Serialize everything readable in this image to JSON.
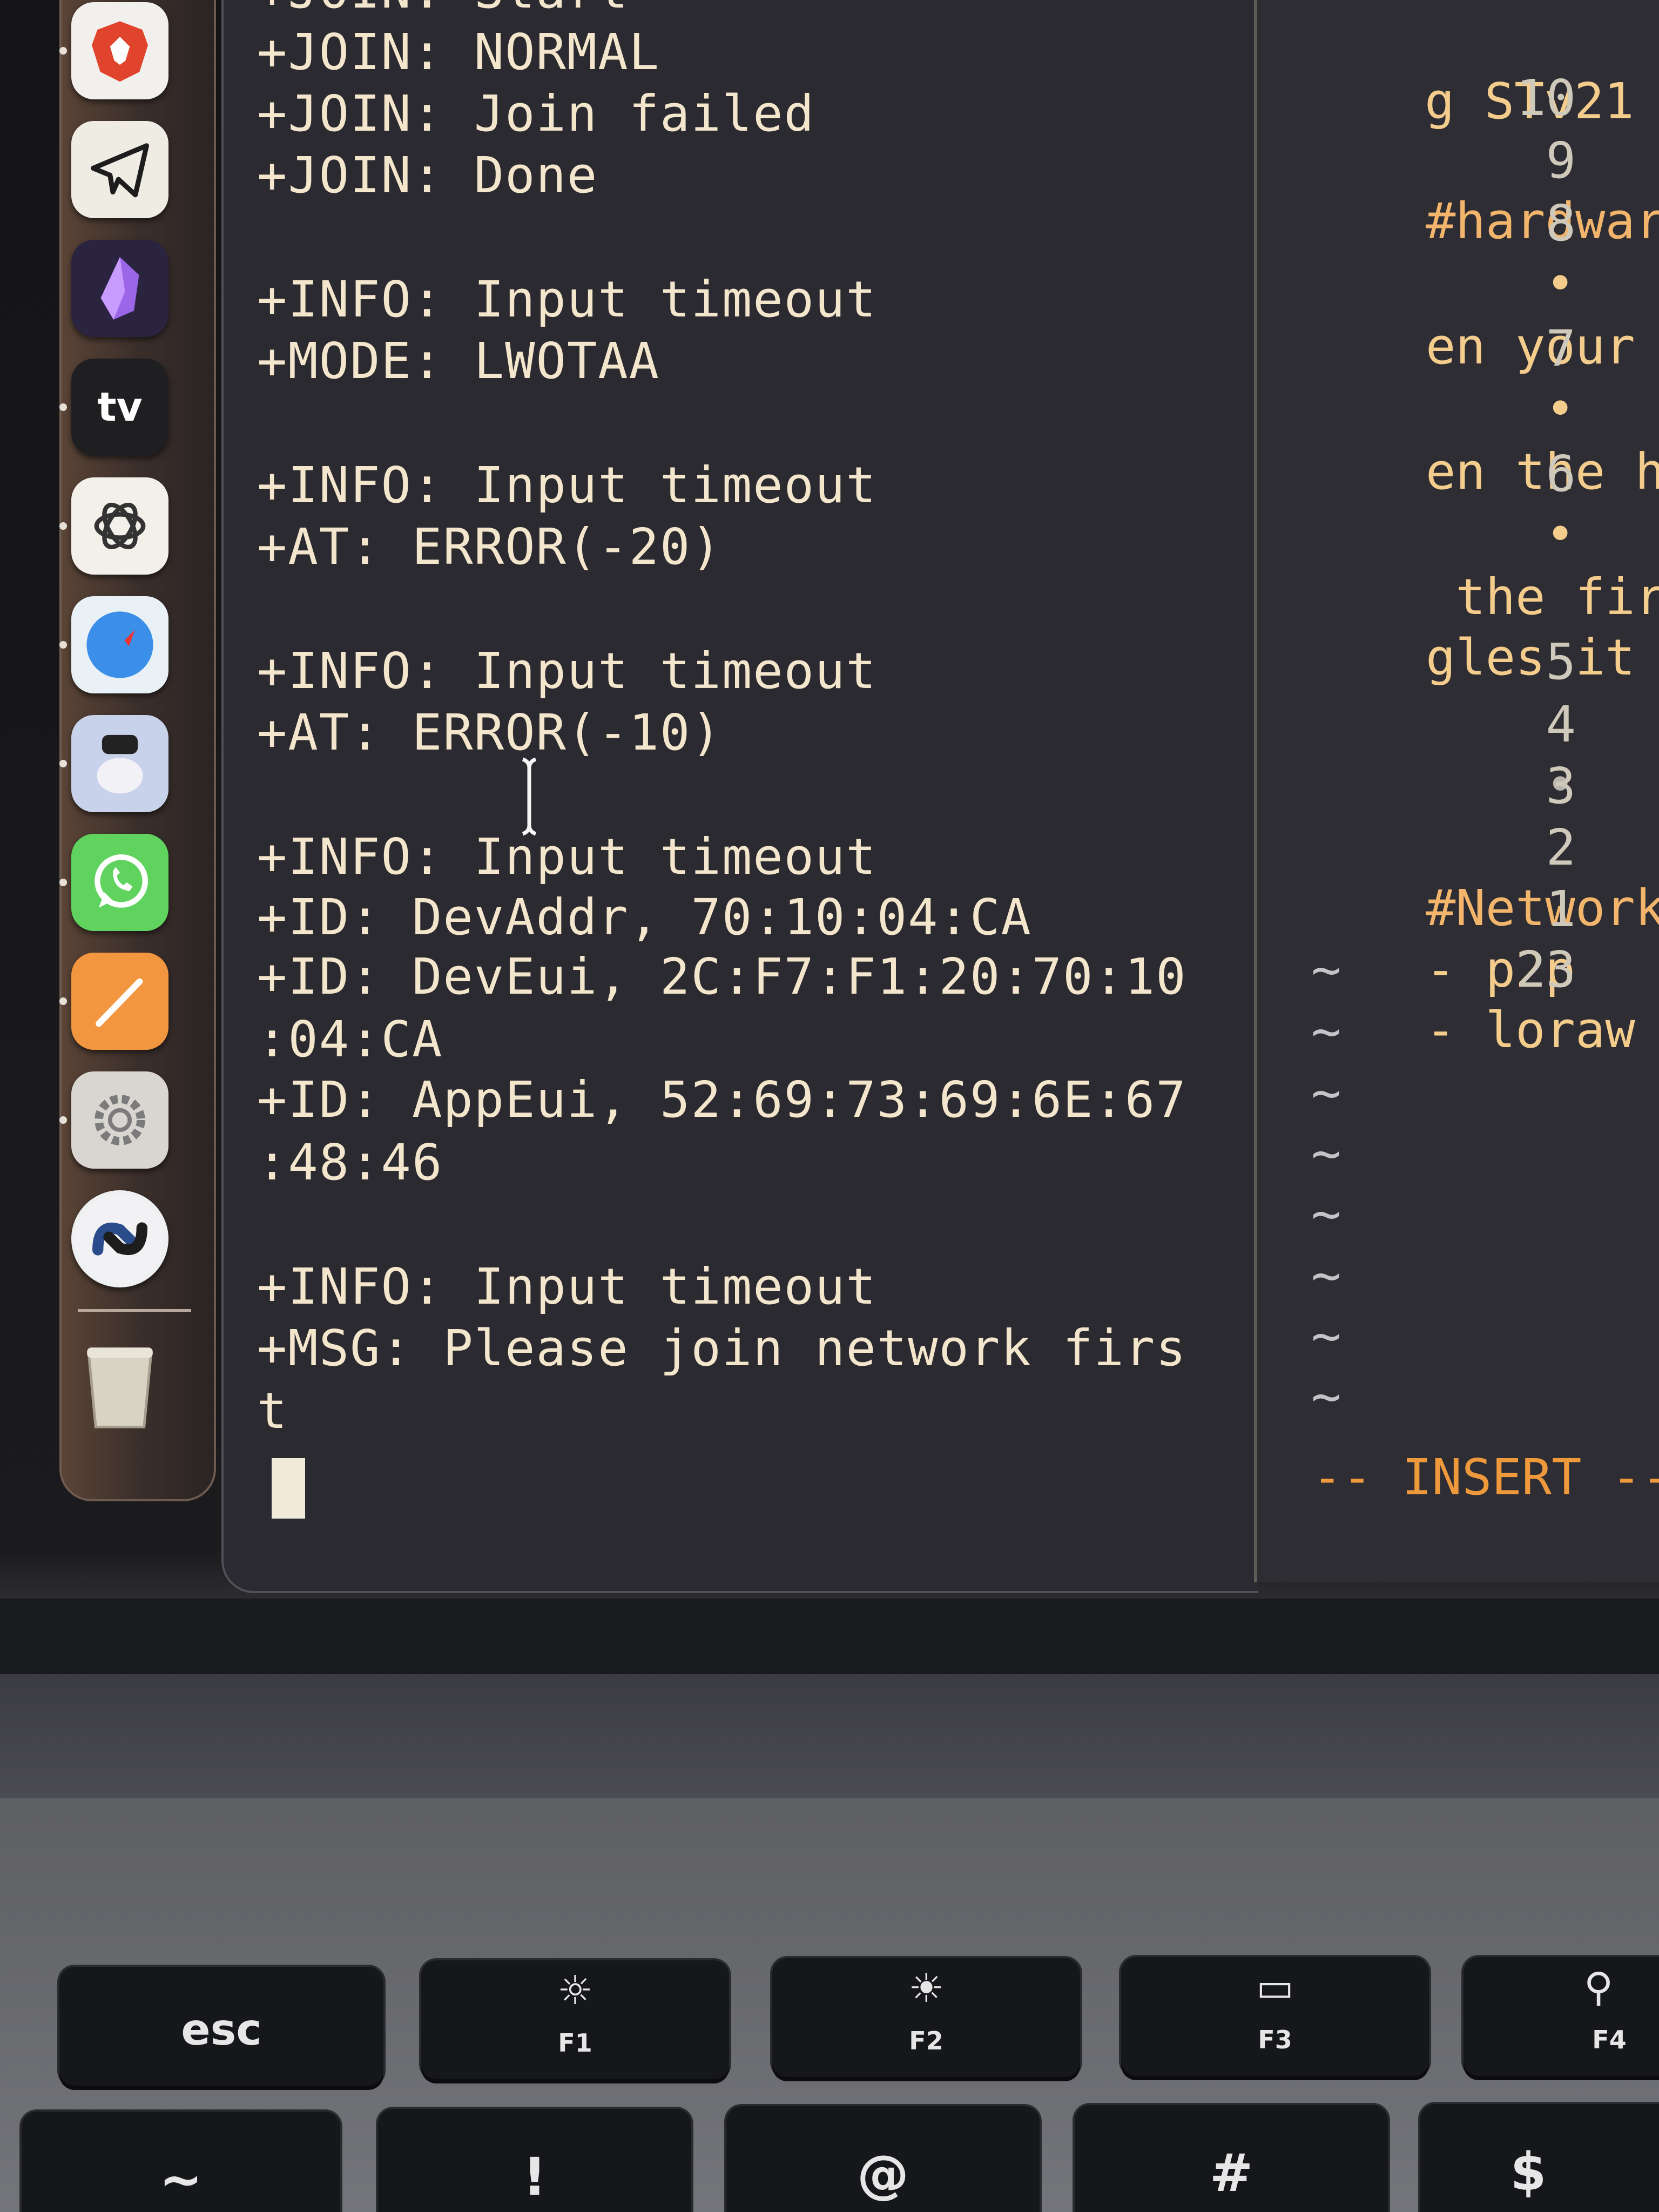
{
  "dock": {
    "items": [
      {
        "name": "brave-browser-icon",
        "glyph": "🦁",
        "bg": "#f2f0ed"
      },
      {
        "name": "telegram-icon",
        "glyph": "✈",
        "bg": "#efece4"
      },
      {
        "name": "obsidian-icon",
        "glyph": "◆",
        "bg": "#2b2440"
      },
      {
        "name": "apple-tv-icon",
        "glyph": "tv",
        "bg": "#1f1f22"
      },
      {
        "name": "chatgpt-icon",
        "glyph": "❀",
        "bg": "#f3f0ea"
      },
      {
        "name": "safari-icon",
        "glyph": "🧭",
        "bg": "#e9f0f6"
      },
      {
        "name": "preview-icon",
        "glyph": "◉",
        "bg": "#c8d2ea"
      },
      {
        "name": "whatsapp-icon",
        "glyph": "✆",
        "bg": "#5fd35e"
      },
      {
        "name": "pages-icon",
        "glyph": "✎",
        "bg": "#f29640"
      },
      {
        "name": "system-settings-icon",
        "glyph": "⚙",
        "bg": "#d9d6d1"
      },
      {
        "name": "sync-app-icon",
        "glyph": "⇄",
        "bg": "#eef0f2"
      },
      {
        "name": "trash-icon",
        "glyph": "🗑",
        "bg": "transparent"
      }
    ]
  },
  "terminal": {
    "lines": [
      "+JOIN: Start",
      "+JOIN: NORMAL",
      "+JOIN: Join failed",
      "+JOIN: Done",
      "",
      "+INFO: Input timeout",
      "+MODE: LWOTAA",
      "",
      "+INFO: Input timeout",
      "+AT: ERROR(-20)",
      "",
      "+INFO: Input timeout",
      "+AT: ERROR(-10)",
      "",
      "+INFO: Input timeout",
      "+ID: DevAddr, 70:10:04:CA",
      "+ID: DevEui, 2C:F7:F1:20:70:10",
      ":04:CA",
      "+ID: AppEui, 52:69:73:69:6E:67",
      ":48:46",
      "",
      "+INFO: Input timeout",
      "+MSG: Please join network firs",
      "t"
    ]
  },
  "vim": {
    "rows": [
      {
        "num": "",
        "text": "g STv21"
      },
      {
        "num": "10",
        "text": ""
      },
      {
        "num": "9",
        "text": "#hardwar",
        "heading": true
      },
      {
        "num": "8",
        "text": "    •"
      },
      {
        "num": "",
        "text": "en your"
      },
      {
        "num": "7",
        "text": "    •"
      },
      {
        "num": "",
        "text": "en the h"
      },
      {
        "num": "6",
        "text": "    •"
      },
      {
        "num": "",
        "text": " the fir"
      },
      {
        "num": "",
        "text": "gles it"
      },
      {
        "num": "5",
        "text": ""
      },
      {
        "num": "4",
        "text": "    •"
      },
      {
        "num": "3",
        "text": ""
      },
      {
        "num": "2",
        "text": "#Network",
        "heading": true
      },
      {
        "num": "1",
        "text": "- p2p"
      },
      {
        "num": "23",
        "text": "- loraw"
      }
    ],
    "tildes": [
      "~",
      "~",
      "~",
      "~",
      "~",
      "~",
      "~",
      "~"
    ],
    "mode": "-- INSERT --"
  },
  "keyboard": {
    "fn_row": [
      {
        "name": "esc-key",
        "label": "esc",
        "icon": ""
      },
      {
        "name": "f1-key",
        "label": "F1",
        "icon": "☼"
      },
      {
        "name": "f2-key",
        "label": "F2",
        "icon": "☀"
      },
      {
        "name": "f3-key",
        "label": "F3",
        "icon": "▭"
      },
      {
        "name": "f4-key",
        "label": "F4",
        "icon": "⚲"
      }
    ],
    "num_row": [
      {
        "name": "tilde-key",
        "label": "~"
      },
      {
        "name": "exclamation-key",
        "label": "!"
      },
      {
        "name": "at-key",
        "label": "@"
      },
      {
        "name": "hash-key",
        "label": "#"
      },
      {
        "name": "dollar-key",
        "label": "$"
      }
    ]
  }
}
